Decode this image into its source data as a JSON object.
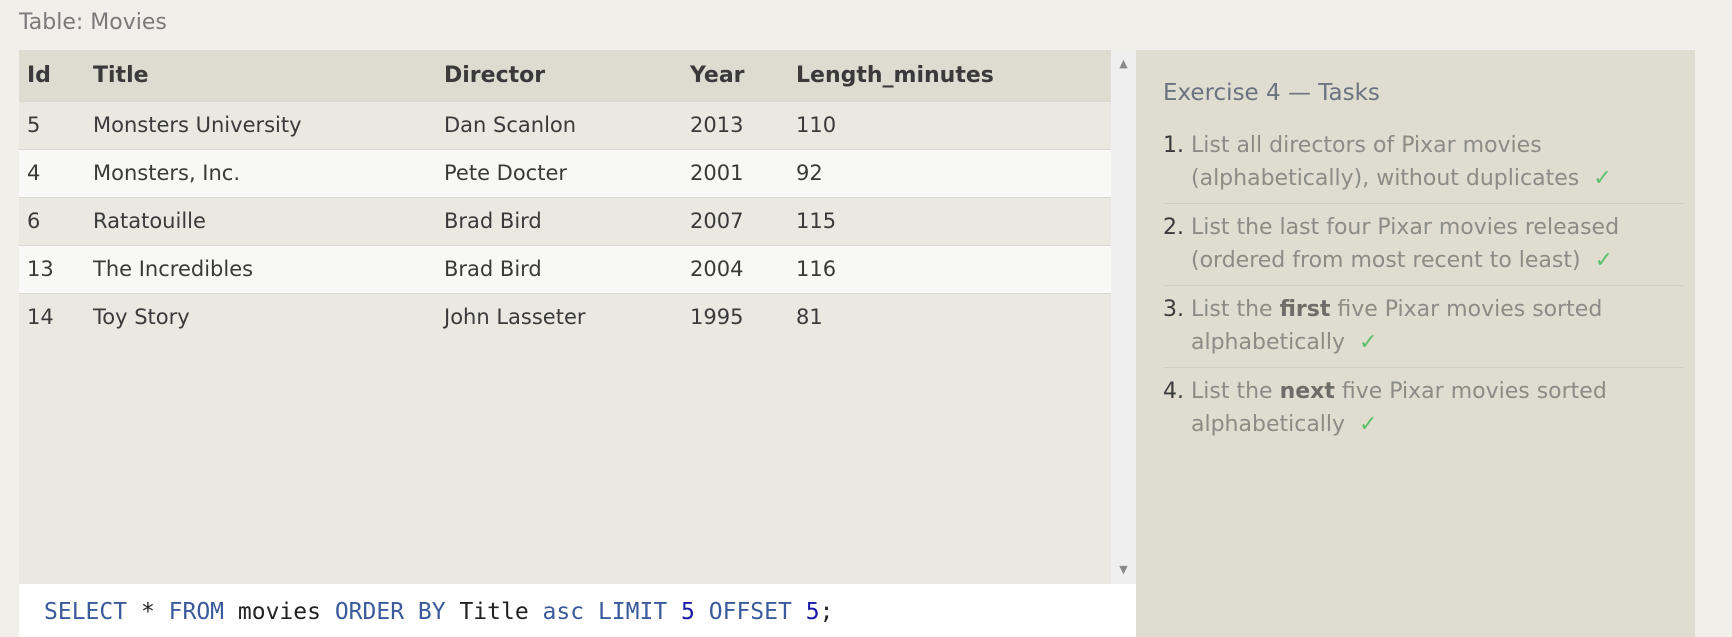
{
  "table_caption": "Table: Movies",
  "results": {
    "columns": [
      "Id",
      "Title",
      "Director",
      "Year",
      "Length_minutes"
    ],
    "rows": [
      [
        "5",
        "Monsters University",
        "Dan Scanlon",
        "2013",
        "110"
      ],
      [
        "4",
        "Monsters, Inc.",
        "Pete Docter",
        "2001",
        "92"
      ],
      [
        "6",
        "Ratatouille",
        "Brad Bird",
        "2007",
        "115"
      ],
      [
        "13",
        "The Incredibles",
        "Brad Bird",
        "2004",
        "116"
      ],
      [
        "14",
        "Toy Story",
        "John Lasseter",
        "1995",
        "81"
      ]
    ]
  },
  "query": {
    "kw_select": "SELECT",
    "star": " * ",
    "kw_from": "FROM",
    "table": " movies ",
    "kw_order_by": "ORDER BY",
    "column": " Title ",
    "kw_asc": "asc",
    "space1": " ",
    "kw_limit": "LIMIT",
    "space2": " ",
    "limit_value": "5",
    "space3": " ",
    "kw_offset": "OFFSET",
    "space4": " ",
    "offset_value": "5",
    "terminator": ";"
  },
  "tasks": {
    "title": "Exercise 4 — Tasks",
    "items": [
      {
        "number": "1.",
        "text_before": "List all directors of Pixar movies (alphabetically), without duplicates",
        "bold": "",
        "text_after": "",
        "check": "✓"
      },
      {
        "number": "2.",
        "text_before": "List the last four Pixar movies released (ordered from most recent to least)",
        "bold": "",
        "text_after": "",
        "check": "✓"
      },
      {
        "number": "3.",
        "text_before": "List the ",
        "bold": "first",
        "text_after": " five Pixar movies sorted alphabetically",
        "check": "✓"
      },
      {
        "number": "4.",
        "text_before": "List the ",
        "bold": "next",
        "text_after": " five Pixar movies sorted alphabetically",
        "check": "✓"
      }
    ]
  },
  "scrollbar": {
    "up_icon": "▲",
    "down_icon": "▼"
  },
  "colors": {
    "sql_keyword": "#3a5a9b",
    "sql_number": "#1a1aa6",
    "check": "#5fbf6a"
  }
}
